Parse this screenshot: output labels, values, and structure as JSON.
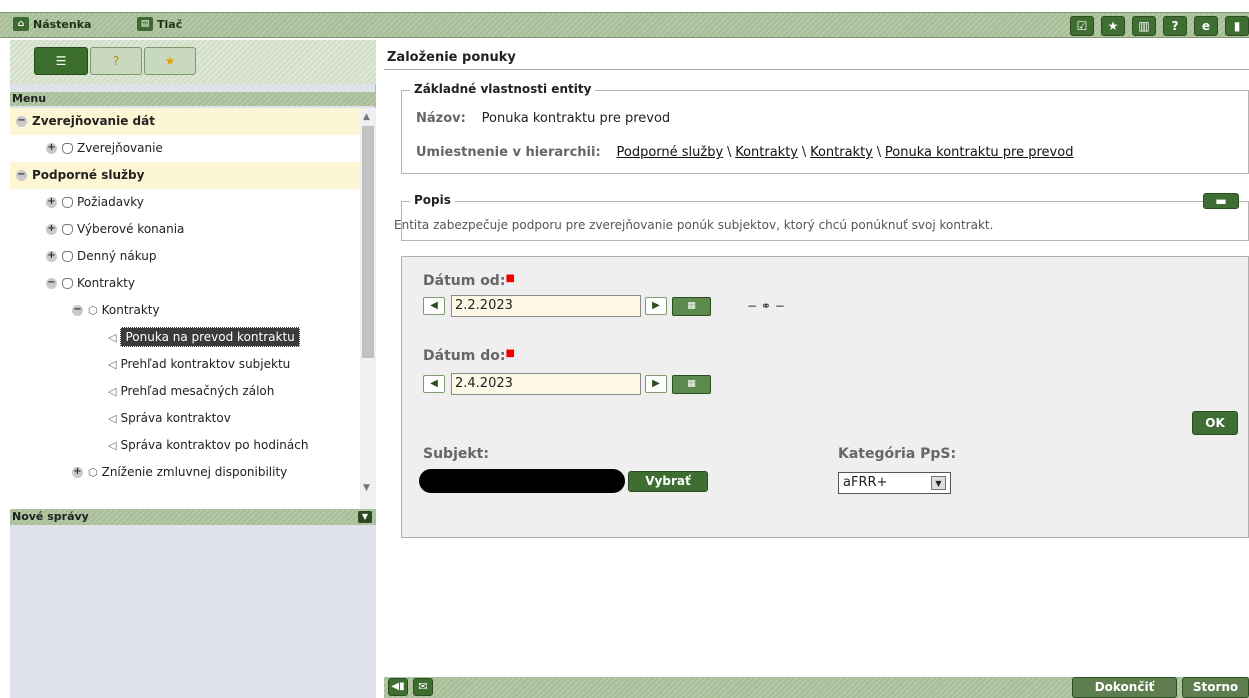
{
  "topbar": {
    "dashboard_label": "Nástenka",
    "print_label": "Tlač",
    "icons": [
      "checklist-icon",
      "star-icon",
      "building-icon",
      "help-icon",
      "refresh-icon",
      "exit-icon"
    ]
  },
  "left_panel": {
    "tabs": [
      "list-icon",
      "help-icon",
      "star-icon"
    ],
    "menu_title": "Menu",
    "news_title": "Nové správy",
    "tree": [
      {
        "label": "Zverejňovanie dát",
        "level": 0,
        "expander": "−",
        "kind": "section"
      },
      {
        "label": "Zverejňovanie",
        "level": 1,
        "expander": "+",
        "kind": "db"
      },
      {
        "label": "Podporné služby",
        "level": 0,
        "expander": "−",
        "kind": "section"
      },
      {
        "label": "Požiadavky",
        "level": 1,
        "expander": "+",
        "kind": "db"
      },
      {
        "label": "Výberové konania",
        "level": 1,
        "expander": "+",
        "kind": "db"
      },
      {
        "label": "Denný nákup",
        "level": 1,
        "expander": "+",
        "kind": "db"
      },
      {
        "label": "Kontrakty",
        "level": 1,
        "expander": "−",
        "kind": "db"
      },
      {
        "label": "Kontrakty",
        "level": 2,
        "expander": "−",
        "kind": "cube"
      },
      {
        "label": "Ponuka na prevod kontraktu",
        "level": 3,
        "kind": "leaf",
        "selected": true
      },
      {
        "label": "Prehľad kontraktov subjektu",
        "level": 3,
        "kind": "leaf"
      },
      {
        "label": "Prehľad mesačných záloh",
        "level": 3,
        "kind": "leaf"
      },
      {
        "label": "Správa kontraktov",
        "level": 3,
        "kind": "leaf"
      },
      {
        "label": "Správa kontraktov po hodinách",
        "level": 3,
        "kind": "leaf"
      },
      {
        "label": "Zníženie zmluvnej disponibility",
        "level": 2,
        "expander": "+",
        "kind": "cube"
      }
    ]
  },
  "main": {
    "title": "Založenie ponuky",
    "basic": {
      "legend": "Základné vlastnosti entity",
      "name_key": "Názov:",
      "name_value": "Ponuka kontraktu pre prevod",
      "loc_key": "Umiestnenie v hierarchii:",
      "breadcrumb": [
        "Podporné služby",
        "Kontrakty",
        "Kontrakty",
        "Ponuka kontraktu pre prevod"
      ],
      "separator": "\\"
    },
    "popis": {
      "legend": "Popis",
      "text": "Entita zabezpečuje podporu pre zverejňovanie ponúk subjektov, ktorý chcú ponúknuť svoj kontrakt."
    },
    "form": {
      "date_from_label": "Dátum od:",
      "date_from_value": "2.2.2023",
      "date_to_label": "Dátum do:",
      "date_to_value": "2.4.2023",
      "link_glyph": "− ⚭ −",
      "ok_label": "OK",
      "subject_label": "Subjekt:",
      "select_button": "Vybrať",
      "category_label": "Kategória PpS:",
      "category_value": "aFRR+"
    },
    "footer": {
      "finish": "Dokončiť",
      "cancel": "Storno"
    }
  },
  "colors": {
    "brand_green": "#3f6e32",
    "hatch_green": "#a9bf9a",
    "required_red": "#ee0000",
    "highlight_row": "#fdf6d4"
  }
}
